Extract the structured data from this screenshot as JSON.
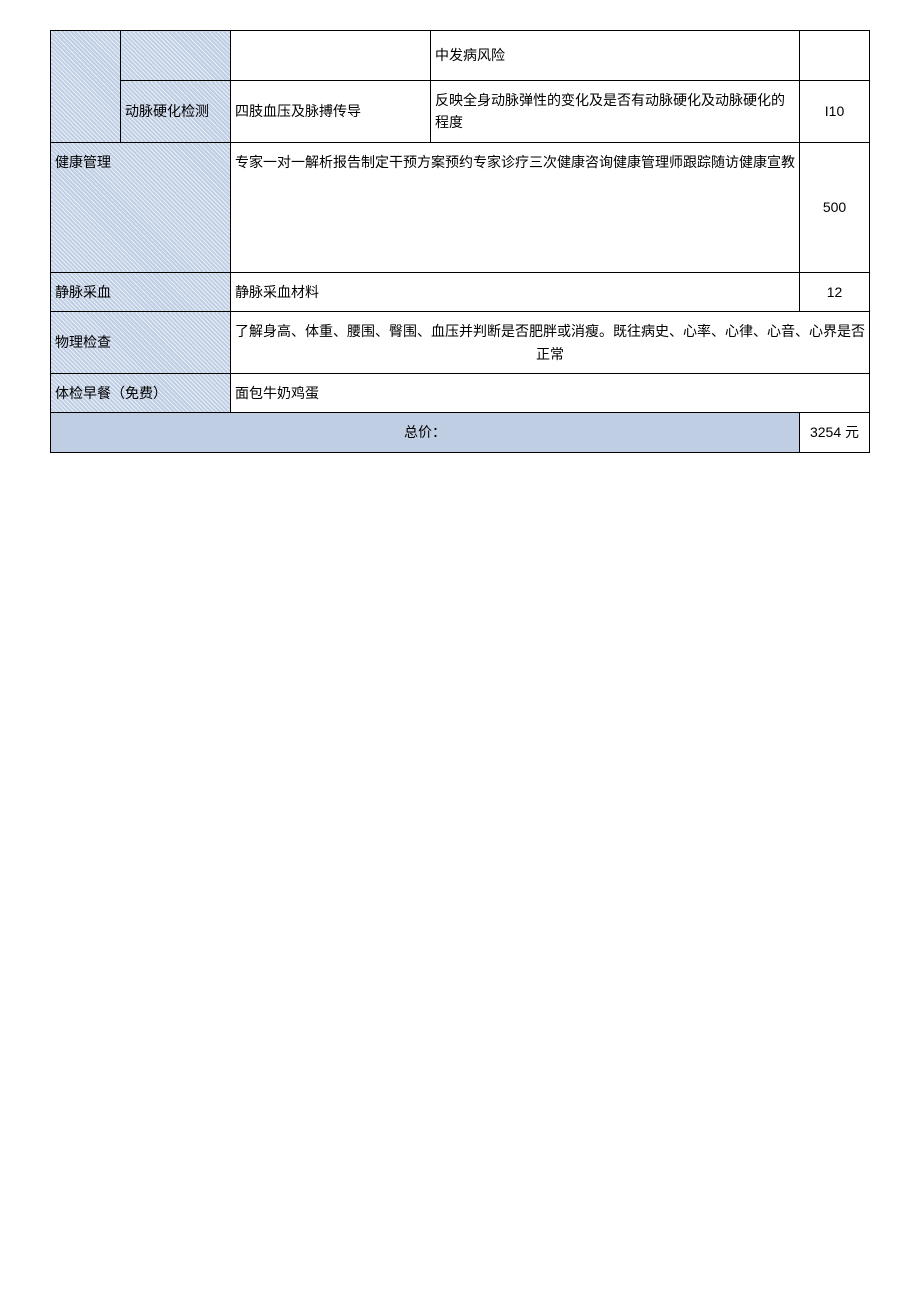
{
  "rows": {
    "row1": {
      "category": "",
      "item": "",
      "method": "",
      "desc": "中发病风险",
      "price": ""
    },
    "row2": {
      "item": "动脉硬化检测",
      "method": "四肢血压及脉搏传导",
      "desc": "反映全身动脉弹性的变化及是否有动脉硬化及动脉硬化的程度",
      "price": "I10"
    },
    "row3": {
      "label": "健康管理",
      "desc": "专家一对一解析报告制定干预方案预约专家诊疗三次健康咨询健康管理师跟踪随访健康宣教",
      "price": "500"
    },
    "row4": {
      "label": "静脉采血",
      "desc": "静脉采血材料",
      "price": "12"
    },
    "row5": {
      "label": "物理检查",
      "desc": "了解身高、体重、腰围、臀围、血压并判断是否肥胖或消瘦。既往病史、心率、心律、心音、心界是否正常"
    },
    "row6": {
      "label": "体检早餐（免费）",
      "desc": "面包牛奶鸡蛋"
    },
    "row7": {
      "label": "总价：",
      "price": "3254 元"
    }
  }
}
